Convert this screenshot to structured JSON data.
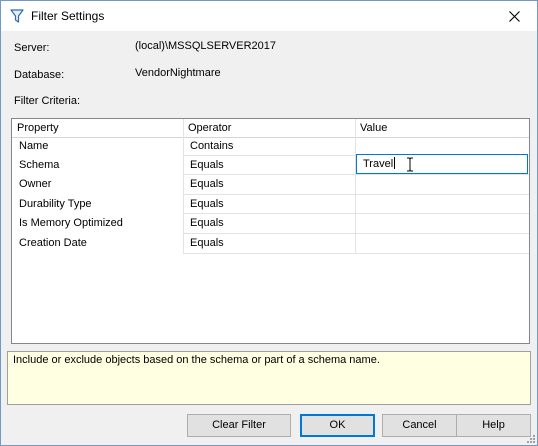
{
  "window": {
    "title": "Filter Settings"
  },
  "info": {
    "server_label": "Server:",
    "server_value": "(local)\\MSSQLSERVER2017",
    "database_label": "Database:",
    "database_value": "VendorNightmare",
    "criteria_label": "Filter Criteria:"
  },
  "grid": {
    "headers": [
      "Property",
      "Operator",
      "Value"
    ],
    "rows": [
      {
        "property": "Name",
        "operator": "Contains",
        "value": ""
      },
      {
        "property": "Schema",
        "operator": "Equals",
        "value": "Travel"
      },
      {
        "property": "Owner",
        "operator": "Equals",
        "value": ""
      },
      {
        "property": "Durability Type",
        "operator": "Equals",
        "value": ""
      },
      {
        "property": "Is Memory Optimized",
        "operator": "Equals",
        "value": ""
      },
      {
        "property": "Creation Date",
        "operator": "Equals",
        "value": ""
      }
    ]
  },
  "description": "Include or exclude objects based on the schema or part of a schema name.",
  "buttons": {
    "clear_filter": "Clear Filter",
    "ok": "OK",
    "cancel": "Cancel",
    "help": "Help"
  },
  "icons": {
    "title": "filter-icon",
    "close": "close-icon",
    "cursor": "text-cursor-icon",
    "grip": "resize-grip-icon"
  },
  "colors": {
    "accent": "#0078d7",
    "description_bg": "#ffffe1",
    "dialog_bg": "#f0f0f0"
  }
}
